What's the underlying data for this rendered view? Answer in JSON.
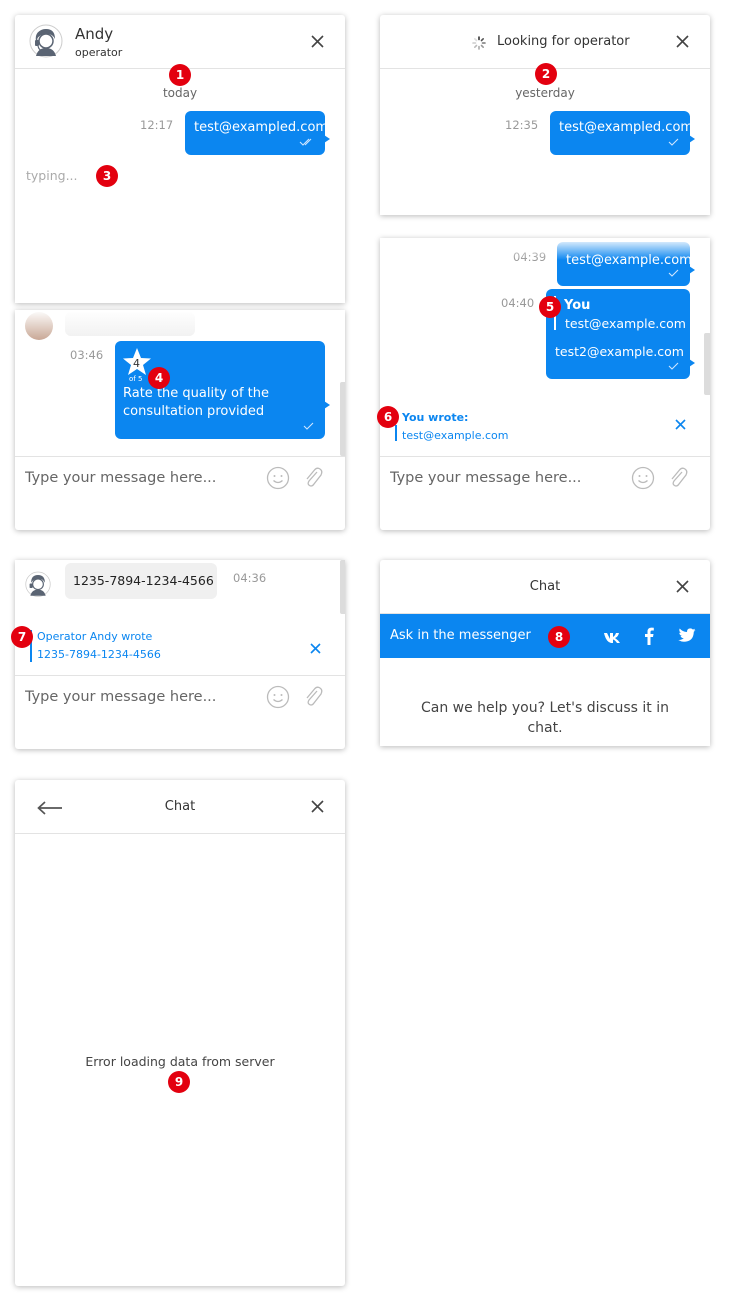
{
  "panel1": {
    "name": "Andy",
    "role": "operator",
    "date": "today",
    "time": "12:17",
    "message": "test@exampled.com",
    "typing": "typing...",
    "badge_date": "1",
    "badge_typing": "3"
  },
  "panel2": {
    "title": "Looking for operator",
    "date": "yesterday",
    "time": "12:35",
    "message": "test@exampled.com",
    "badge": "2"
  },
  "panel3": {
    "time": "03:46",
    "rating_value": "4",
    "rating_of": "of 5",
    "rating_text": "Rate the quality of the consultation provided",
    "input_placeholder": "Type your message here...",
    "badge": "4"
  },
  "panel4": {
    "time1": "04:39",
    "msg1": "test@example.com",
    "time2": "04:40",
    "you_label": "You",
    "you_quote": "test@example.com",
    "msg2": "test2@example.com",
    "reply_title": "You wrote:",
    "reply_text": "test@example.com",
    "input_placeholder": "Type your message here...",
    "badge_you": "5",
    "badge_reply": "6"
  },
  "panel5": {
    "message": "1235-7894-1234-4566",
    "time": "04:36",
    "reply_title": "Operator Andy wrote",
    "reply_text": "1235-7894-1234-4566",
    "input_placeholder": "Type your message here...",
    "badge": "7"
  },
  "panel6": {
    "title": "Chat",
    "bar_text": "Ask in the messenger",
    "prompt": "Can we help you? Let's discuss it in chat.",
    "badge": "8",
    "icons": [
      "vk-icon",
      "facebook-icon",
      "twitter-icon"
    ]
  },
  "panel7": {
    "title": "Chat",
    "error": "Error loading data from server",
    "badge": "9"
  },
  "colors": {
    "accent": "#0b86f0",
    "badge": "#e3000f"
  }
}
